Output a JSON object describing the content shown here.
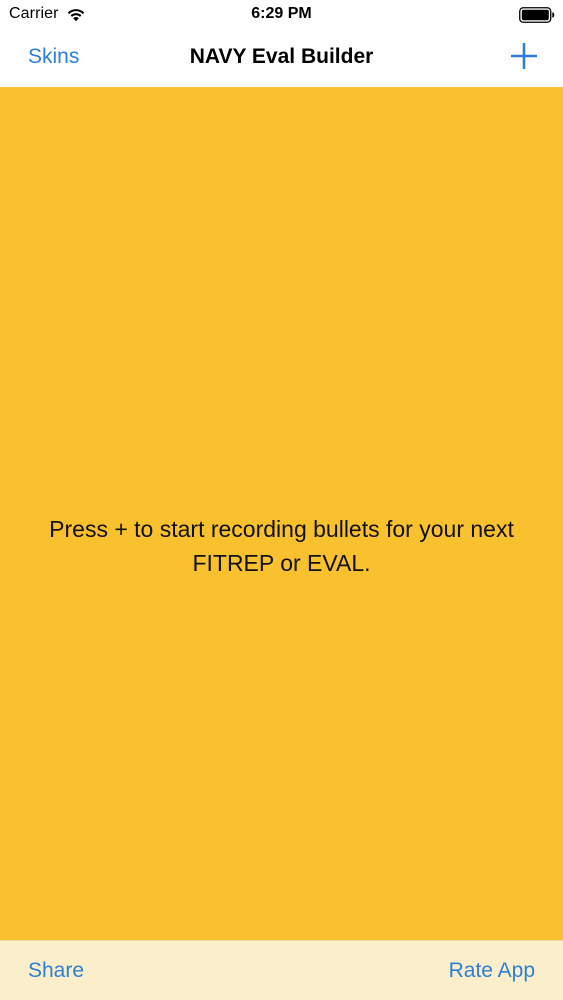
{
  "status_bar": {
    "carrier": "Carrier",
    "time": "6:29 PM",
    "wifi_icon": "wifi-icon",
    "battery_icon": "battery-icon"
  },
  "nav_bar": {
    "left_label": "Skins",
    "title": "NAVY Eval Builder",
    "add_icon": "plus-icon"
  },
  "main": {
    "empty_message": "Press + to start recording bullets for your next FITREP or EVAL."
  },
  "toolbar": {
    "share_label": "Share",
    "rate_label": "Rate App"
  },
  "colors": {
    "accent": "#2d7fd6",
    "content_background": "#fac12f",
    "toolbar_background": "#faeecb"
  }
}
